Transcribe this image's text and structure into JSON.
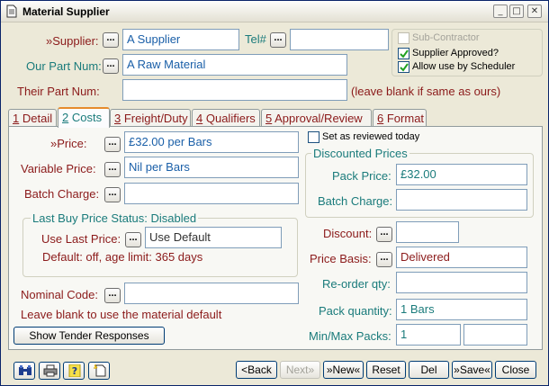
{
  "window": {
    "title": "Material Supplier"
  },
  "supplier": {
    "label": "»Supplier:",
    "value": "A Supplier"
  },
  "tel": {
    "label": "Tel#",
    "value": ""
  },
  "our_part": {
    "label": "Our Part Num:",
    "value": "A Raw Material"
  },
  "their_part": {
    "label": "Their Part Num:",
    "value": "",
    "hint": "(leave blank if same as ours)"
  },
  "flags": {
    "sub_contractor": {
      "label": "Sub-Contractor",
      "checked": false,
      "disabled": true
    },
    "supplier_approved": {
      "label": "Supplier Approved?",
      "checked": true
    },
    "allow_scheduler": {
      "label": "Allow use by Scheduler",
      "checked": true
    }
  },
  "tabs": [
    {
      "key": "1",
      "label": "Detail",
      "active": false
    },
    {
      "key": "2",
      "label": "Costs",
      "active": true
    },
    {
      "key": "3",
      "label": "Freight/Duty",
      "active": false
    },
    {
      "key": "4",
      "label": "Qualifiers",
      "active": false
    },
    {
      "key": "5",
      "label": "Approval/Review",
      "active": false
    },
    {
      "key": "6",
      "label": "Format",
      "active": false
    }
  ],
  "costs": {
    "price": {
      "label": "»Price:",
      "value": "£32.00 per Bars"
    },
    "variable_price": {
      "label": "Variable Price:",
      "value": "Nil per Bars"
    },
    "batch_charge": {
      "label": "Batch Charge:",
      "value": ""
    },
    "last_buy": {
      "title": "Last Buy Price Status: Disabled",
      "use_label": "Use Last Price:",
      "use_value": "Use Default",
      "default_text": "Default: off, age limit: 365 days"
    },
    "nominal_code": {
      "label": "Nominal Code:",
      "value": "",
      "hint": "Leave blank to use the material default"
    },
    "show_tender_button": "Show Tender Responses",
    "reviewed_today": {
      "label": "Set as reviewed today",
      "checked": false
    },
    "discounted": {
      "title": "Discounted Prices",
      "pack_price_label": "Pack Price:",
      "pack_price_value": "£32.00",
      "batch_charge_label": "Batch Charge:",
      "batch_charge_value": ""
    },
    "discount": {
      "label": "Discount:",
      "value": ""
    },
    "price_basis": {
      "label": "Price Basis:",
      "value": "Delivered"
    },
    "reorder_qty": {
      "label": "Re-order qty:",
      "value": ""
    },
    "pack_quantity": {
      "label": "Pack quantity:",
      "value": "1 Bars"
    },
    "min_max_packs": {
      "label": "Min/Max Packs:",
      "min": "1",
      "max": ""
    }
  },
  "footer": {
    "back": "Back",
    "next": "Next»",
    "new": "»New«",
    "reset": "Reset",
    "del": "Del",
    "save": "»Save«",
    "close": "Close"
  },
  "icons": [
    "binoculars-icon",
    "printer-icon",
    "help-icon",
    "new-document-icon"
  ]
}
